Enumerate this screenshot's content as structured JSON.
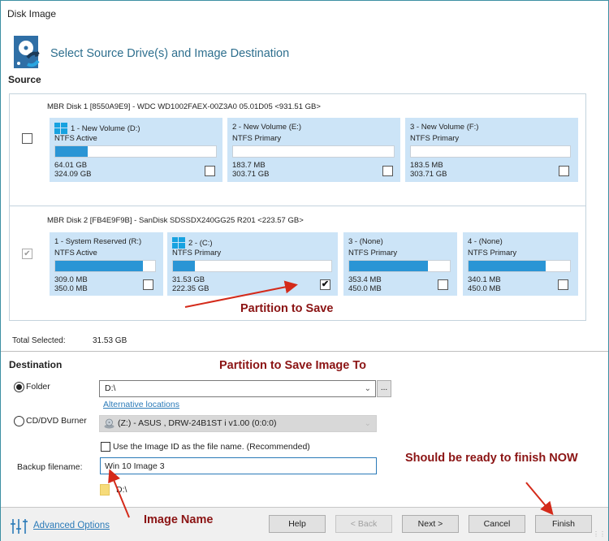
{
  "window": {
    "title": "Disk Image"
  },
  "header": {
    "icon": "disk-image-icon",
    "text": "Select Source Drive(s) and Image Destination"
  },
  "source": {
    "label": "Source",
    "disks": [
      {
        "title": "MBR Disk 1 [8550A9E9] - WDC WD1002FAEX-00Z3A0 05.01D05  <931.51 GB>",
        "checked": false,
        "partitions": [
          {
            "name": "1 - New Volume (D:)",
            "type": "NTFS Active",
            "used": "64.01 GB",
            "total": "324.09 GB",
            "fill_fraction": 0.2,
            "checked": false,
            "windows_logo": true
          },
          {
            "name": "2 - New Volume (E:)",
            "type": "NTFS Primary",
            "used": "183.7 MB",
            "total": "303.71 GB",
            "fill_fraction": 0.0,
            "checked": false,
            "windows_logo": false
          },
          {
            "name": "3 - New Volume (F:)",
            "type": "NTFS Primary",
            "used": "183.5 MB",
            "total": "303.71 GB",
            "fill_fraction": 0.0,
            "checked": false,
            "windows_logo": false
          }
        ]
      },
      {
        "title": "MBR Disk 2 [FB4E9F9B] - SanDisk SDSSDX240GG25 R201  <223.57 GB>",
        "checked": true,
        "partitions": [
          {
            "name": "1 - System Reserved (R:)",
            "type": "NTFS Active",
            "used": "309.0 MB",
            "total": "350.0 MB",
            "fill_fraction": 0.88,
            "checked": false,
            "windows_logo": false
          },
          {
            "name": "2 -  (C:)",
            "type": "NTFS Primary",
            "used": "31.53 GB",
            "total": "222.35 GB",
            "fill_fraction": 0.14,
            "checked": true,
            "windows_logo": true
          },
          {
            "name": "3 -  (None)",
            "type": "NTFS Primary",
            "used": "353.4 MB",
            "total": "450.0 MB",
            "fill_fraction": 0.78,
            "checked": false,
            "windows_logo": false
          },
          {
            "name": "4 -  (None)",
            "type": "NTFS Primary",
            "used": "340.1 MB",
            "total": "450.0 MB",
            "fill_fraction": 0.76,
            "checked": false,
            "windows_logo": false
          }
        ]
      }
    ],
    "total_selected_label": "Total Selected:",
    "total_selected_value": "31.53 GB"
  },
  "destination": {
    "label": "Destination",
    "folder_option": {
      "label": "Folder",
      "selected": true,
      "value": "D:\\",
      "browse_label": "..."
    },
    "alternative_locations_link": "Alternative locations",
    "cd_option": {
      "label": "CD/DVD Burner",
      "selected": false,
      "value": "(Z:) - ASUS    , DRW-24B1ST   i   v1.00 (0:0:0)"
    },
    "use_image_id": {
      "label": "Use the Image ID as the file name.  (Recommended)",
      "checked": false
    },
    "backup_filename": {
      "label": "Backup filename:",
      "value": "Win 10 Image 3"
    },
    "path_preview": "D:\\"
  },
  "footer": {
    "advanced_options": "Advanced Options",
    "buttons": {
      "help": "Help",
      "back": "< Back",
      "next": "Next >",
      "cancel": "Cancel",
      "finish": "Finish"
    }
  },
  "annotations": {
    "partition_to_save": "Partition to Save",
    "partition_to_save_image_to": "Partition to Save Image To",
    "ready_to_finish": "Should be ready to finish NOW",
    "image_name": "Image Name",
    "color": "#8b1414",
    "arrow_color": "#d42a1a"
  },
  "colors": {
    "accent": "#2a95d5",
    "partition_bg": "#cce4f7",
    "link": "#2a7ab8",
    "frame": "#3d8fa3"
  }
}
